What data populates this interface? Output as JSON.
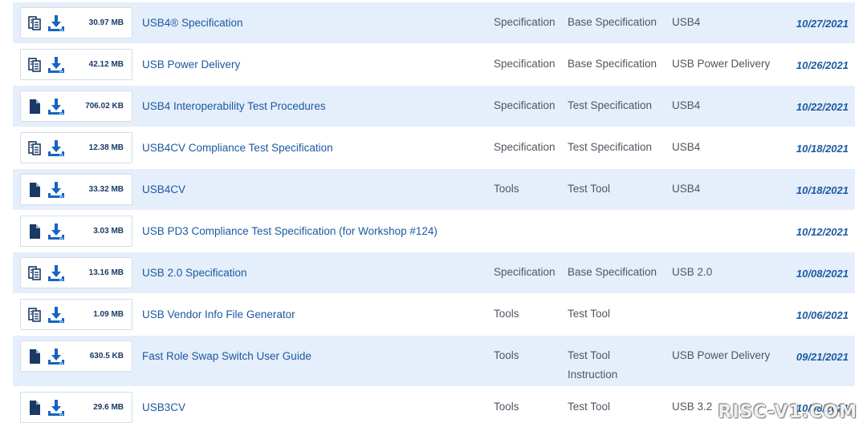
{
  "rows": [
    {
      "file_icon": "multi-file-icon",
      "size": "30.97 MB",
      "title": "USB4® Specification",
      "type": "Specification",
      "subtype": "Base Specification",
      "subtype2": "",
      "category": "USB4",
      "date": "10/27/2021",
      "shaded": true
    },
    {
      "file_icon": "multi-file-icon",
      "size": "42.12 MB",
      "title": "USB Power Delivery",
      "type": "Specification",
      "subtype": "Base Specification",
      "subtype2": "",
      "category": "USB Power Delivery",
      "date": "10/26/2021",
      "shaded": false
    },
    {
      "file_icon": "document-icon",
      "size": "706.02 KB",
      "title": "USB4 Interoperability Test Procedures",
      "type": "Specification",
      "subtype": "Test Specification",
      "subtype2": "",
      "category": "USB4",
      "date": "10/22/2021",
      "shaded": true
    },
    {
      "file_icon": "multi-file-icon",
      "size": "12.38 MB",
      "title": "USB4CV Compliance Test Specification",
      "type": "Specification",
      "subtype": "Test Specification",
      "subtype2": "",
      "category": "USB4",
      "date": "10/18/2021",
      "shaded": false
    },
    {
      "file_icon": "document-icon",
      "size": "33.32 MB",
      "title": "USB4CV",
      "type": "Tools",
      "subtype": "Test Tool",
      "subtype2": "",
      "category": "USB4",
      "date": "10/18/2021",
      "shaded": true
    },
    {
      "file_icon": "document-icon",
      "size": "3.03 MB",
      "title": "USB PD3 Compliance Test Specification (for Workshop #124)",
      "type": "",
      "subtype": "",
      "subtype2": "",
      "category": "",
      "date": "10/12/2021",
      "shaded": false
    },
    {
      "file_icon": "multi-file-icon",
      "size": "13.16 MB",
      "title": "USB 2.0 Specification",
      "type": "Specification",
      "subtype": "Base Specification",
      "subtype2": "",
      "category": "USB 2.0",
      "date": "10/08/2021",
      "shaded": true
    },
    {
      "file_icon": "multi-file-icon",
      "size": "1.09 MB",
      "title": "USB Vendor Info File Generator",
      "type": "Tools",
      "subtype": "Test Tool",
      "subtype2": "",
      "category": "",
      "date": "10/06/2021",
      "shaded": false
    },
    {
      "file_icon": "document-icon",
      "size": "630.5 KB",
      "title": "Fast Role Swap Switch User Guide",
      "type": "Tools",
      "subtype": "Test Tool",
      "subtype2": "Instruction",
      "category": "USB Power Delivery",
      "date": "09/21/2021",
      "shaded": true
    },
    {
      "file_icon": "document-icon",
      "size": "29.6 MB",
      "title": "USB3CV",
      "type": "Tools",
      "subtype": "Test Tool",
      "subtype2": "",
      "category": "USB 3.2",
      "date": "10/08/2021",
      "shaded": false
    }
  ],
  "download_icon": "download-icon",
  "watermark": "RISC-V1.COM",
  "colors": {
    "row_shade": "#e5eefb",
    "link": "#1b5aa0",
    "icon": "#1565c0",
    "text": "#505660"
  }
}
